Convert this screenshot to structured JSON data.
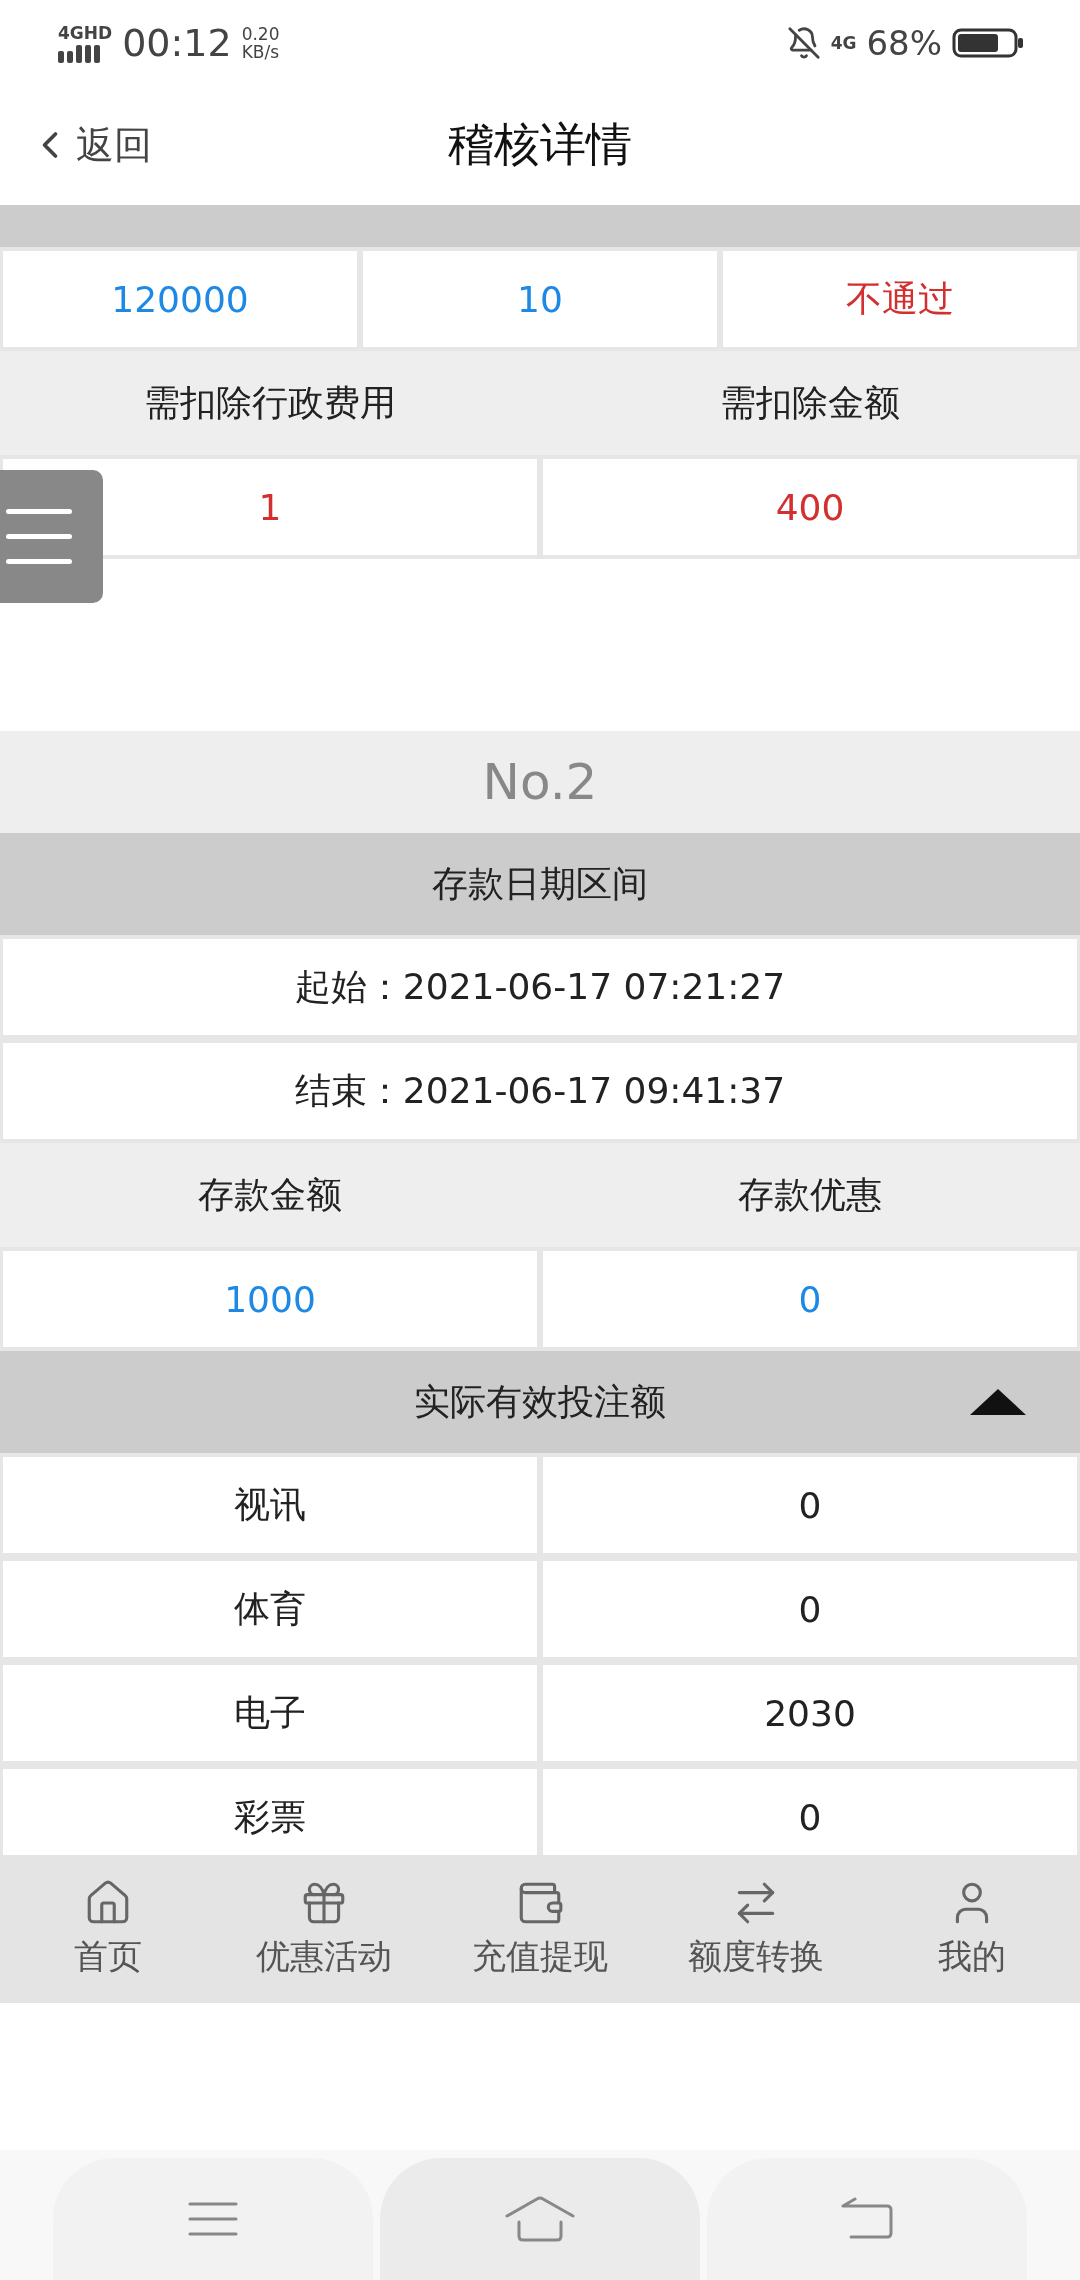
{
  "status_bar": {
    "network_left": "4GHD",
    "time": "00:12",
    "speed": "0.20",
    "speed_unit": "KB/s",
    "network_right": "4G",
    "battery": "68%"
  },
  "header": {
    "back": "返回",
    "title": "稽核详情"
  },
  "blocks": [
    {
      "kind": "bar"
    },
    {
      "kind": "values",
      "cells": [
        {
          "text": "120000",
          "color": "#1e88e5"
        },
        {
          "text": "10",
          "color": "#1e88e5"
        },
        {
          "text": "不通过",
          "color": "#d32f2f"
        }
      ]
    },
    {
      "kind": "labels",
      "cells": [
        {
          "text": "需扣除行政费用"
        },
        {
          "text": "需扣除金额"
        }
      ]
    },
    {
      "kind": "values",
      "cells": [
        {
          "text": "1",
          "color": "#d32f2f"
        },
        {
          "text": "400",
          "color": "#d32f2f"
        }
      ]
    },
    {
      "kind": "spacer"
    },
    {
      "kind": "number",
      "text": "No.2"
    },
    {
      "kind": "heading",
      "text": "存款日期区间"
    },
    {
      "kind": "values",
      "cells": [
        {
          "text": "起始：2021-06-17 07:21:27",
          "color": "#222222"
        }
      ]
    },
    {
      "kind": "values",
      "cells": [
        {
          "text": "结束：2021-06-17 09:41:37",
          "color": "#222222"
        }
      ]
    },
    {
      "kind": "labels",
      "cells": [
        {
          "text": "存款金额"
        },
        {
          "text": "存款优惠"
        }
      ]
    },
    {
      "kind": "values",
      "cells": [
        {
          "text": "1000",
          "color": "#1e88e5"
        },
        {
          "text": "0",
          "color": "#1e88e5"
        }
      ]
    },
    {
      "kind": "heading",
      "text": "实际有效投注额",
      "expanded": true
    },
    {
      "kind": "values",
      "cells": [
        {
          "text": "视讯",
          "color": "#222222"
        },
        {
          "text": "0",
          "color": "#222222"
        }
      ]
    },
    {
      "kind": "values",
      "cells": [
        {
          "text": "体育",
          "color": "#222222"
        },
        {
          "text": "0",
          "color": "#222222"
        }
      ]
    },
    {
      "kind": "values",
      "cells": [
        {
          "text": "电子",
          "color": "#222222"
        },
        {
          "text": "2030",
          "color": "#222222"
        }
      ]
    },
    {
      "kind": "values",
      "cells": [
        {
          "text": "彩票",
          "color": "#222222"
        },
        {
          "text": "0",
          "color": "#222222"
        }
      ]
    }
  ],
  "bottom_nav": [
    {
      "label": "首页"
    },
    {
      "label": "优惠活动"
    },
    {
      "label": "充值提现"
    },
    {
      "label": "额度转换"
    },
    {
      "label": "我的"
    }
  ]
}
